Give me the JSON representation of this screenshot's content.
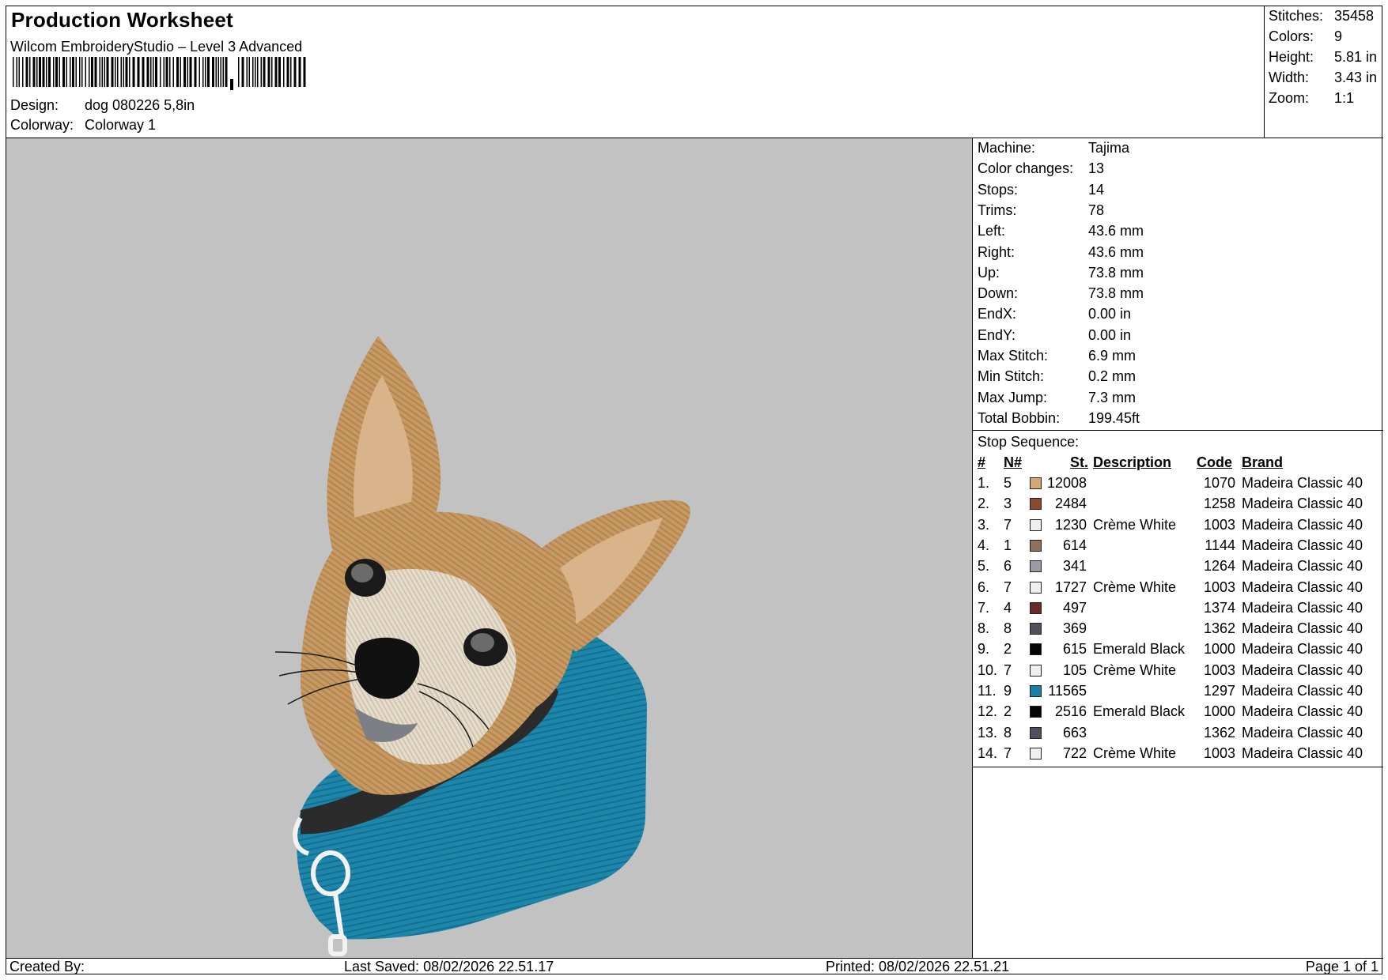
{
  "header": {
    "title": "Production Worksheet",
    "software": "Wilcom EmbroideryStudio – Level 3 Advanced",
    "design_label": "Design:",
    "design_value": "dog 080226 5,8in",
    "colorway_label": "Colorway:",
    "colorway_value": "Colorway 1"
  },
  "summary": {
    "stitches_label": "Stitches:",
    "stitches_value": "35458",
    "colors_label": "Colors:",
    "colors_value": "9",
    "height_label": "Height:",
    "height_value": "5.81 in",
    "width_label": "Width:",
    "width_value": "3.43 in",
    "zoom_label": "Zoom:",
    "zoom_value": "1:1"
  },
  "machine": [
    {
      "label": "Machine:",
      "value": "Tajima"
    },
    {
      "label": "Color changes:",
      "value": "13"
    },
    {
      "label": "Stops:",
      "value": "14"
    },
    {
      "label": "Trims:",
      "value": "78"
    },
    {
      "label": "Left:",
      "value": "43.6 mm"
    },
    {
      "label": "Right:",
      "value": "43.6 mm"
    },
    {
      "label": "Up:",
      "value": "73.8 mm"
    },
    {
      "label": "Down:",
      "value": "73.8 mm"
    },
    {
      "label": "EndX:",
      "value": "0.00 in"
    },
    {
      "label": "EndY:",
      "value": "0.00 in"
    },
    {
      "label": "Max Stitch:",
      "value": "6.9 mm"
    },
    {
      "label": "Min Stitch:",
      "value": "0.2 mm"
    },
    {
      "label": "Max Jump:",
      "value": "7.3 mm"
    },
    {
      "label": "Total Bobbin:",
      "value": "199.45ft"
    }
  ],
  "stop_sequence": {
    "heading": "Stop Sequence:",
    "columns": {
      "idx": "#",
      "num": "N#",
      "st": "St.",
      "desc": "Description",
      "code": "Code",
      "brand": "Brand"
    },
    "rows": [
      {
        "idx": "1.",
        "num": "5",
        "color": "#d5a772",
        "st": "12008",
        "desc": "",
        "code": "1070",
        "brand": "Madeira Classic 40"
      },
      {
        "idx": "2.",
        "num": "3",
        "color": "#8b4a2c",
        "st": "2484",
        "desc": "",
        "code": "1258",
        "brand": "Madeira Classic 40"
      },
      {
        "idx": "3.",
        "num": "7",
        "color": "#efefef",
        "st": "1230",
        "desc": "Crème White",
        "code": "1003",
        "brand": "Madeira Classic 40"
      },
      {
        "idx": "4.",
        "num": "1",
        "color": "#8e715d",
        "st": "614",
        "desc": "",
        "code": "1144",
        "brand": "Madeira Classic 40"
      },
      {
        "idx": "5.",
        "num": "6",
        "color": "#9c9aa6",
        "st": "341",
        "desc": "",
        "code": "1264",
        "brand": "Madeira Classic 40"
      },
      {
        "idx": "6.",
        "num": "7",
        "color": "#efefef",
        "st": "1727",
        "desc": "Crème White",
        "code": "1003",
        "brand": "Madeira Classic 40"
      },
      {
        "idx": "7.",
        "num": "4",
        "color": "#6a2a2a",
        "st": "497",
        "desc": "",
        "code": "1374",
        "brand": "Madeira Classic 40"
      },
      {
        "idx": "8.",
        "num": "8",
        "color": "#4f4f5e",
        "st": "369",
        "desc": "",
        "code": "1362",
        "brand": "Madeira Classic 40"
      },
      {
        "idx": "9.",
        "num": "2",
        "color": "#050505",
        "st": "615",
        "desc": "Emerald Black",
        "code": "1000",
        "brand": "Madeira Classic 40"
      },
      {
        "idx": "10.",
        "num": "7",
        "color": "#efefef",
        "st": "105",
        "desc": "Crème White",
        "code": "1003",
        "brand": "Madeira Classic 40"
      },
      {
        "idx": "11.",
        "num": "9",
        "color": "#1b7fa6",
        "st": "11565",
        "desc": "",
        "code": "1297",
        "brand": "Madeira Classic 40"
      },
      {
        "idx": "12.",
        "num": "2",
        "color": "#050505",
        "st": "2516",
        "desc": "Emerald Black",
        "code": "1000",
        "brand": "Madeira Classic 40"
      },
      {
        "idx": "13.",
        "num": "8",
        "color": "#4f4f5e",
        "st": "663",
        "desc": "",
        "code": "1362",
        "brand": "Madeira Classic 40"
      },
      {
        "idx": "14.",
        "num": "7",
        "color": "#efefef",
        "st": "722",
        "desc": "Crème White",
        "code": "1003",
        "brand": "Madeira Classic 40"
      }
    ]
  },
  "footer": {
    "created_by": "Created By:",
    "last_saved": "Last Saved: 08/02/2026 22.51.17",
    "printed": "Printed: 08/02/2026 22.51.21",
    "page": "Page 1 of 1"
  }
}
